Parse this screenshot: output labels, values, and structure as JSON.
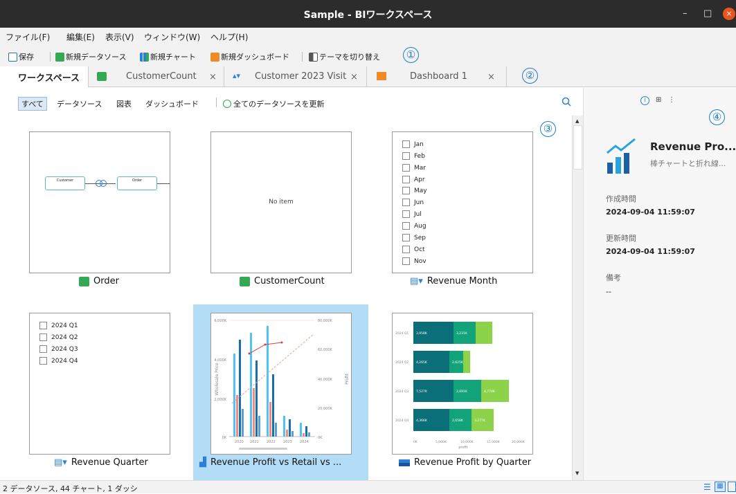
{
  "window": {
    "title": "Sample - BIワークスペース",
    "min": "–",
    "max": "□",
    "close": "×"
  },
  "menu": [
    "ファイル(F)",
    "編集(E)",
    "表示(V)",
    "ウィンドウ(W)",
    "ヘルプ(H)"
  ],
  "toolbar": {
    "save": "保存",
    "new_datasource": "新規データソース",
    "new_chart": "新規チャート",
    "new_dashboard": "新規ダッシュボード",
    "theme": "テーマを切り替え"
  },
  "callouts": [
    "①",
    "②",
    "③",
    "④"
  ],
  "tabs": [
    {
      "label": "ワークスペース"
    },
    {
      "label": "CustomerCount",
      "close": "×"
    },
    {
      "label": "Customer 2023 Visit",
      "close": "×"
    },
    {
      "label": "Dashboard 1",
      "close": "×"
    }
  ],
  "filters": {
    "all": "すべて",
    "datasource": "データソース",
    "chart": "図表",
    "dashboard": "ダッシュボード",
    "refresh": "全てのデータソースを更新"
  },
  "cards": [
    {
      "label": "Order",
      "diagram": {
        "node1": "Customer",
        "node2": "Order"
      }
    },
    {
      "label": "CustomerCount",
      "empty": "No item"
    },
    {
      "label": "Revenue Month",
      "months": [
        "Jan",
        "Feb",
        "Mar",
        "Apr",
        "May",
        "Jun",
        "Jul",
        "Aug",
        "Sep",
        "Oct",
        "Nov"
      ]
    },
    {
      "label": "Revenue Quarter",
      "quarters": [
        "2024 Q1",
        "2024 Q2",
        "2024 Q3",
        "2024 Q4"
      ]
    },
    {
      "label": "Revenue Profit vs Retail vs ...",
      "axis_left": "Wholesale Price",
      "axis_right": "Profit",
      "yticks_left": [
        "6,000K",
        "4,000K",
        "2,000K",
        "0K"
      ],
      "yticks_right": [
        "80,000K",
        "60,000K",
        "40,000K",
        "20,000K",
        "0K"
      ],
      "xticks": [
        "2020",
        "2021",
        "2022",
        "2023",
        "2024"
      ]
    },
    {
      "label": "Revenue Profit by Quarter",
      "rows": [
        {
          "q": "2024 Q1",
          "a": "3,958K",
          "b": "3,231K"
        },
        {
          "q": "2024 Q2",
          "a": "4,265K",
          "b": "2,625K"
        },
        {
          "q": "2024 Q3",
          "a": "7,527K",
          "b": "2,691K",
          "c": "4,774K"
        },
        {
          "q": "2024 Q4",
          "a": "4,366K",
          "b": "2,658K",
          "c": "3,277K"
        }
      ],
      "xticks": [
        "0K",
        "5,000K",
        "10,000K",
        "15,000K",
        "20,000K"
      ],
      "xlabel": "profit"
    }
  ],
  "details": {
    "title": "Revenue Pro...",
    "subtitle": "棒チャートと折れ線...",
    "created_label": "作成時間",
    "created": "2024-09-04 11:59:07",
    "updated_label": "更新時間",
    "updated": "2024-09-04 11:59:07",
    "note_label": "備考",
    "note": "--"
  },
  "status": {
    "text": "2 データソース, 44 チャート, 1 ダッシ"
  },
  "colors": {
    "accent": "#1e7ac8",
    "selection": "#b3dcf7",
    "titlebar": "#2c2c2c",
    "close": "#e95420"
  }
}
